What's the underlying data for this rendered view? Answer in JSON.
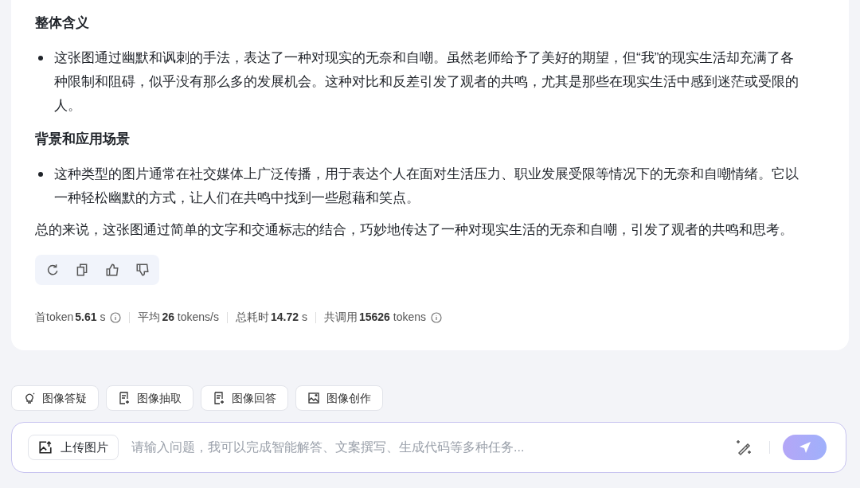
{
  "answer": {
    "sections": [
      {
        "heading": "整体含义",
        "bullets": [
          "这张图通过幽默和讽刺的手法，表达了一种对现实的无奈和自嘲。虽然老师给予了美好的期望，但“我”的现实生活却充满了各种限制和阻碍，似乎没有那么多的发展机会。这种对比和反差引发了观者的共鸣，尤其是那些在现实生活中感到迷茫或受限的人。"
        ]
      },
      {
        "heading": "背景和应用场景",
        "bullets": [
          "这种类型的图片通常在社交媒体上广泛传播，用于表达个人在面对生活压力、职业发展受限等情况下的无奈和自嘲情绪。它以一种轻松幽默的方式，让人们在共鸣中找到一些慰藉和笑点。"
        ]
      }
    ],
    "conclusion": "总的来说，这张图通过简单的文字和交通标志的结合，巧妙地传达了一种对现实生活的无奈和自嘲，引发了观者的共鸣和思考。",
    "actions": [
      {
        "kind": "refresh"
      },
      {
        "kind": "copy"
      },
      {
        "kind": "like"
      },
      {
        "kind": "dislike"
      }
    ],
    "stats": [
      {
        "label": "首token",
        "value": "5.61",
        "unit": "s",
        "info": true
      },
      {
        "label": "平均",
        "value": "26",
        "unit": "tokens/s",
        "info": false
      },
      {
        "label": "总耗时",
        "value": "14.72",
        "unit": "s",
        "info": false
      },
      {
        "label": "共调用",
        "value": "15626",
        "unit": "tokens",
        "info": true
      }
    ]
  },
  "quick_actions": [
    {
      "kind": "bulb",
      "label": "图像答疑"
    },
    {
      "kind": "doc",
      "label": "图像抽取"
    },
    {
      "kind": "doc",
      "label": "图像回答"
    },
    {
      "kind": "image",
      "label": "图像创作"
    }
  ],
  "composer": {
    "upload_label": "上传图片",
    "placeholder": "请输入问题，我可以完成智能解答、文案撰写、生成代码等多种任务..."
  }
}
